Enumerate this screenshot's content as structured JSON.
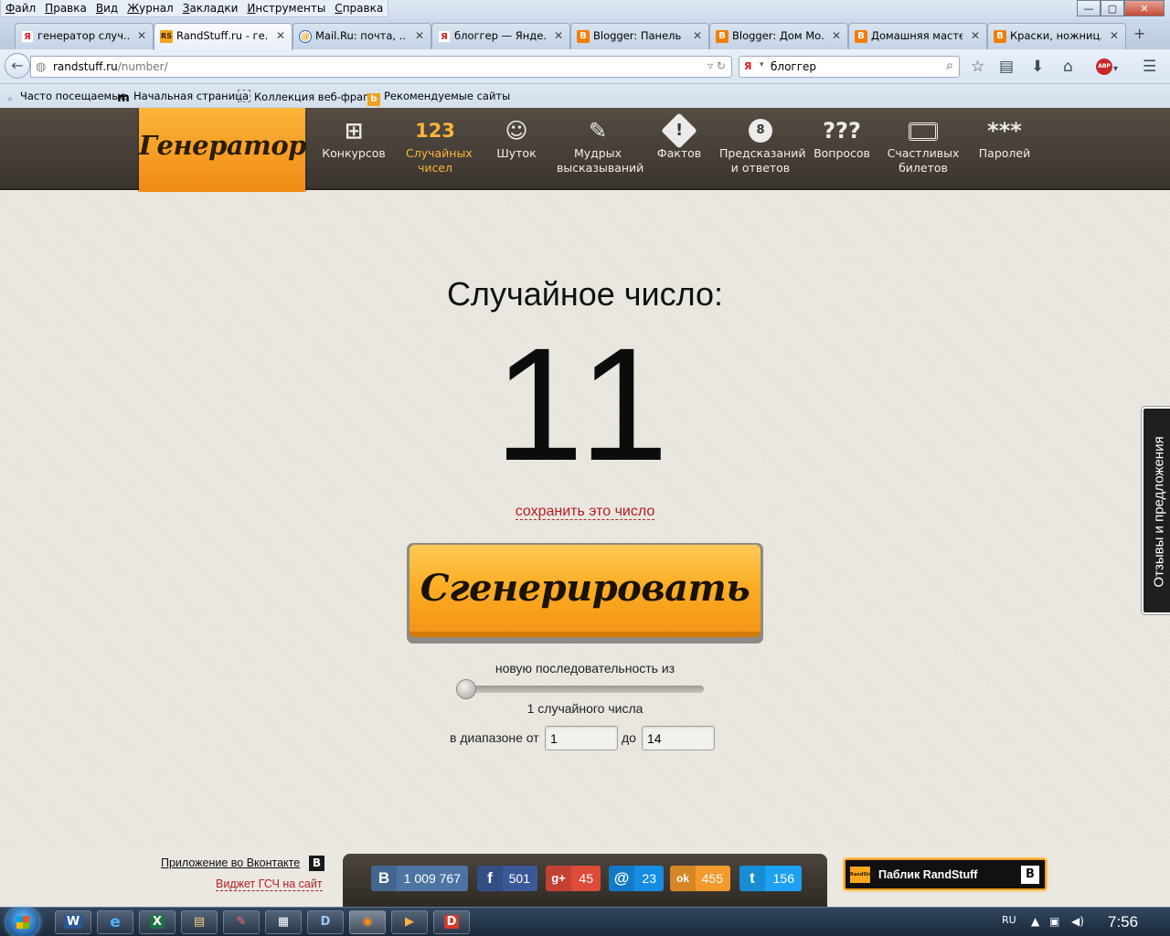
{
  "browser": {
    "menu": [
      "Файл",
      "Правка",
      "Вид",
      "Журнал",
      "Закладки",
      "Инструменты",
      "Справка"
    ],
    "window_controls": {
      "minimize": "—",
      "maximize": "▢",
      "close": "✕"
    },
    "tabs": [
      {
        "title": "генератор случ...",
        "favicon": "Я",
        "active": false
      },
      {
        "title": "RandStuff.ru - ге...",
        "favicon": "RS",
        "active": true
      },
      {
        "title": "Mail.Ru: почта, ...",
        "favicon": "@",
        "active": false
      },
      {
        "title": "блоггер — Янде...",
        "favicon": "Я",
        "active": false
      },
      {
        "title": "Blogger: Панель ...",
        "favicon": "B",
        "active": false
      },
      {
        "title": "Blogger: Дом Мо...",
        "favicon": "B",
        "active": false
      },
      {
        "title": "Домашняя масте...",
        "favicon": "B",
        "active": false
      },
      {
        "title": "Краски, ножниц...",
        "favicon": "B",
        "active": false
      }
    ],
    "tab_close": "✕",
    "new_tab": "+",
    "url_host": "randstuff.ru",
    "url_path": "/number/",
    "search_engine": "Я",
    "search_value": "блоггер",
    "bookmarks": [
      "Часто посещаемые",
      "Начальная страница",
      "Коллекция веб-фраг...",
      "Рекомендуемые сайты"
    ]
  },
  "site": {
    "logo": "Генератор",
    "nav": [
      {
        "label": "Конкурсов",
        "icon": "gift-icon",
        "glyph": "🎁",
        "active": false
      },
      {
        "label": "Случайных чисел",
        "icon": "numbers-icon",
        "glyph": "123",
        "active": true
      },
      {
        "label": "Шуток",
        "icon": "smiley-icon",
        "glyph": "☺",
        "active": false
      },
      {
        "label": "Мудрых высказываний",
        "icon": "scroll-icon",
        "glyph": "✎",
        "active": false
      },
      {
        "label": "Фактов",
        "icon": "warning-icon",
        "glyph": "!",
        "active": false
      },
      {
        "label": "Предсказаний и ответов",
        "icon": "magic-ball-icon",
        "glyph": "8",
        "active": false
      },
      {
        "label": "Вопросов",
        "icon": "question-marks-icon",
        "glyph": "???",
        "active": false
      },
      {
        "label": "Счастливых билетов",
        "icon": "ticket-icon",
        "glyph": "▭",
        "active": false
      },
      {
        "label": "Паролей",
        "icon": "asterisks-icon",
        "glyph": "***",
        "active": false
      }
    ]
  },
  "main": {
    "title": "Случайное число:",
    "number": "11",
    "save_link": "сохранить это число",
    "generate_button": "Сгенерировать",
    "sequence_label": "новую последовательность из",
    "slider_value": 1,
    "count_label": "1 случайного числа",
    "range_from_label": "в диапазоне от",
    "range_to_label": "до",
    "range_from": "1",
    "range_to": "14",
    "feedback": "Отзывы и предложения"
  },
  "footer": {
    "vk_app": "Приложение во Вконтакте",
    "widget": "Виджет ГСЧ на сайт",
    "shares": [
      {
        "network": "vk",
        "icon": "В",
        "count": "1 009 767"
      },
      {
        "network": "facebook",
        "icon": "f",
        "count": "501"
      },
      {
        "network": "google-plus",
        "icon": "g+",
        "count": "45"
      },
      {
        "network": "mailru",
        "icon": "@",
        "count": "23"
      },
      {
        "network": "odnoklassniki",
        "icon": "ok",
        "count": "455"
      },
      {
        "network": "twitter",
        "icon": "t",
        "count": "156"
      }
    ],
    "public_label": "Паблик RandStuff",
    "vk_letter": "В"
  },
  "taskbar": {
    "apps": [
      "W",
      "e",
      "X",
      "▤",
      "✎",
      "▦",
      "D",
      "◉",
      "▶",
      "D"
    ],
    "lang": "RU",
    "time": "7:56"
  }
}
